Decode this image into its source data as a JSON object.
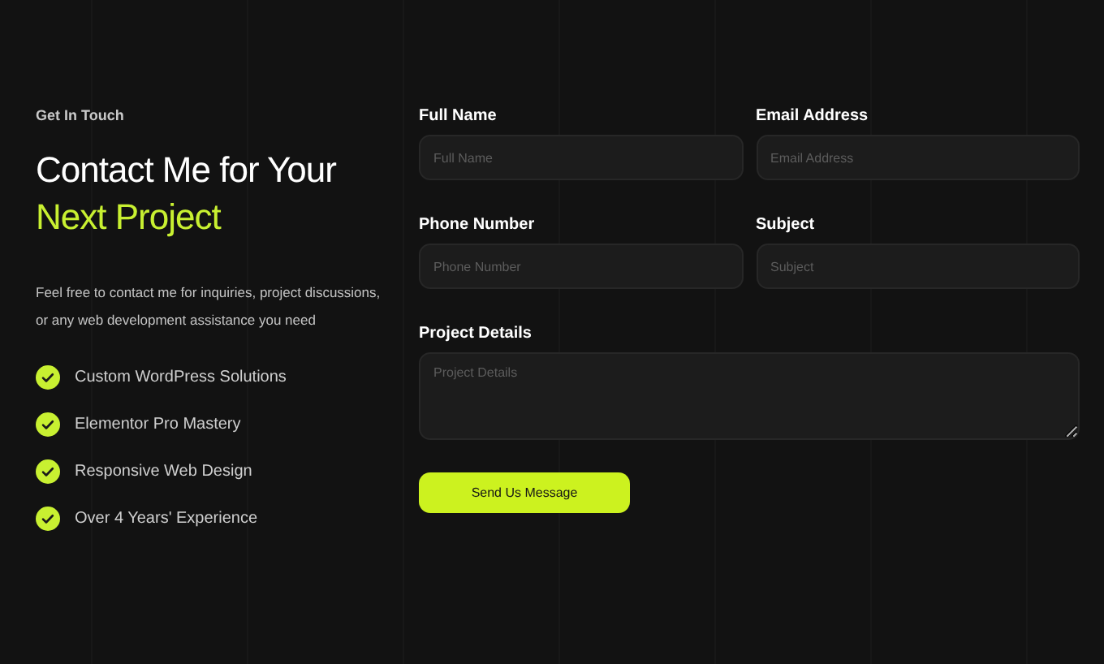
{
  "intro": {
    "eyebrow": "Get In Touch",
    "title_line_1": "Contact Me for Your",
    "title_line_2": "Next Project",
    "description": "Feel free to contact me for inquiries, project discussions, or any web development assistance you need"
  },
  "features": [
    {
      "label": "Custom WordPress Solutions"
    },
    {
      "label": "Elementor Pro Mastery"
    },
    {
      "label": "Responsive Web Design"
    },
    {
      "label": "Over 4 Years' Experience"
    }
  ],
  "form": {
    "fields": [
      {
        "kind": "input",
        "label": "Full Name",
        "placeholder": "Full Name"
      },
      {
        "kind": "input",
        "label": "Email Address",
        "placeholder": "Email Address"
      },
      {
        "kind": "input",
        "label": "Phone Number",
        "placeholder": "Phone Number"
      },
      {
        "kind": "input",
        "label": "Subject",
        "placeholder": "Subject"
      },
      {
        "kind": "textarea",
        "label": "Project Details",
        "placeholder": "Project Details"
      }
    ],
    "submit": "Send Us Message"
  }
}
